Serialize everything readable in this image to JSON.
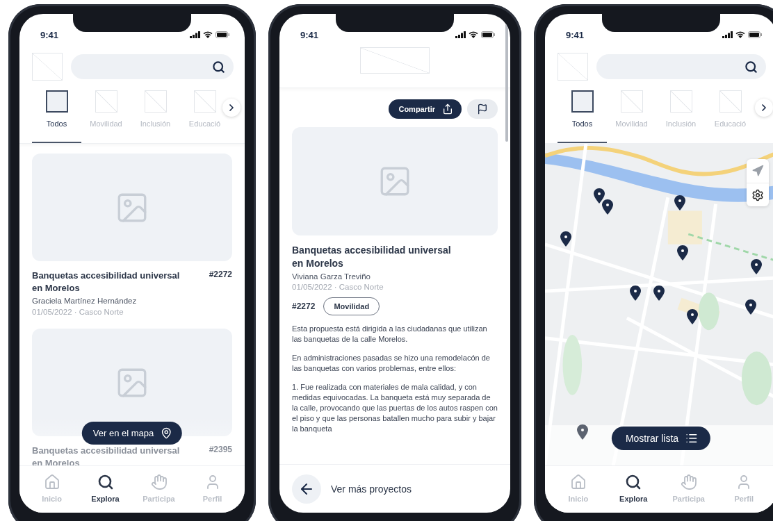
{
  "phones": [
    {
      "kind": "list",
      "time": "9:41",
      "categories": [
        {
          "label": "Todos",
          "selected": true
        },
        {
          "label": "Movilidad",
          "selected": false
        },
        {
          "label": "Inclusión",
          "selected": false
        },
        {
          "label": "Educació",
          "selected": false
        }
      ],
      "cards": [
        {
          "title": "Banquetas accesibilidad universal en Morelos",
          "number": "#2272",
          "author": "Graciela Martínez Hernández",
          "meta": "01/05/2022 ·  Casco Norte"
        },
        {
          "title": "Banquetas accesibilidad universal en Morelos",
          "number": "#2395"
        }
      ],
      "floating_button": "Ver en el mapa",
      "nav": [
        {
          "label": "Inicio",
          "selected": false
        },
        {
          "label": "Explora",
          "selected": true
        },
        {
          "label": "Participa",
          "selected": false
        },
        {
          "label": "Perfil",
          "selected": false
        }
      ]
    },
    {
      "kind": "detail",
      "time": "9:41",
      "share_button": "Compartir",
      "title": "Banquetas accesibilidad universal en Morelos",
      "author": "Viviana Garza Treviño",
      "meta": "01/05/2022 ·  Casco Norte",
      "number": "#2272",
      "tag": "Movilidad",
      "paragraphs": [
        "Esta propuesta está dirigida a las ciudadanas que utilizan las banquetas de la calle Morelos.",
        "En administraciones pasadas se hizo una remodelacón de las banquetas con varios problemas, entre ellos:",
        "1. Fue realizada con materiales de mala calidad, y con medidas equivocadas. La banqueta está muy separada de la calle, provocando que las puertas de los autos raspen con el piso y que las personas batallen mucho para subir y bajar la banqueta"
      ],
      "back_label": "Ver más proyectos"
    },
    {
      "kind": "map",
      "time": "9:41",
      "categories": [
        {
          "label": "Todos",
          "selected": true
        },
        {
          "label": "Movilidad",
          "selected": false
        },
        {
          "label": "Inclusión",
          "selected": false
        },
        {
          "label": "Educació",
          "selected": false
        }
      ],
      "floating_button": "Mostrar lista",
      "nav": [
        {
          "label": "Inicio",
          "selected": false
        },
        {
          "label": "Explora",
          "selected": true
        },
        {
          "label": "Participa",
          "selected": false
        },
        {
          "label": "Perfil",
          "selected": false
        }
      ]
    }
  ]
}
